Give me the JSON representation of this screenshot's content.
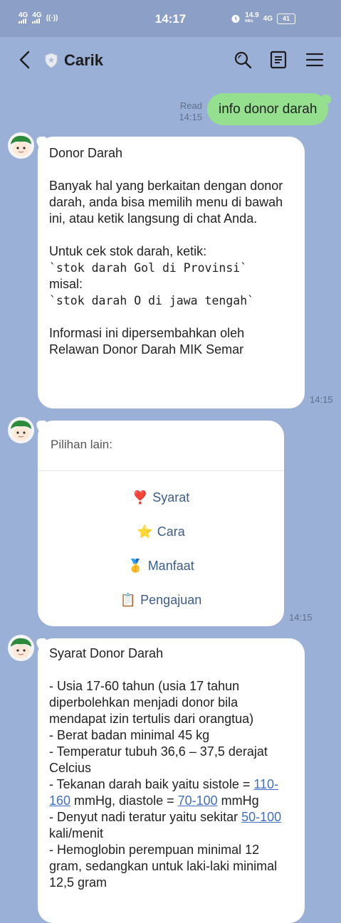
{
  "status": {
    "signal1": "4G",
    "signal2": "4G",
    "time": "14:17",
    "speed": "14.9",
    "speed_unit": "KB/s",
    "net": "4G",
    "battery": "41"
  },
  "header": {
    "title": "Carik"
  },
  "messages": {
    "outgoing": {
      "text": "info donor darah",
      "read": "Read",
      "time": "14:15"
    },
    "m1": {
      "title": "Donor Darah",
      "para1": "Banyak hal yang berkaitan dengan donor darah, anda bisa memilih menu di bawah ini, atau ketik langsung di chat Anda.",
      "line_cek": "Untuk cek stok darah, ketik:",
      "code1": "`stok darah Gol di Provinsi`",
      "misal": "misal:",
      "code2": "`stok darah O di jawa tengah`",
      "info": "Informasi ini dipersembahkan oleh Relawan Donor Darah MIK Semar",
      "time": "14:15"
    },
    "m2": {
      "header": "Pilihan lain:",
      "options": [
        {
          "emoji": "❣️",
          "label": "Syarat"
        },
        {
          "emoji": "⭐",
          "label": "Cara"
        },
        {
          "emoji": "🥇",
          "label": "Manfaat"
        },
        {
          "emoji": "📋",
          "label": "Pengajuan"
        }
      ],
      "time": "14:15"
    },
    "m3": {
      "title": "Syarat Donor Darah",
      "l1": "- Usia 17-60 tahun (usia 17 tahun diperbolehkan menjadi donor bila mendapat izin tertulis dari orangtua)",
      "l2": "- Berat badan minimal 45 kg",
      "l3": "- Temperatur tubuh 36,6 – 37,5 derajat Celcius",
      "l4a": "- Tekanan darah baik yaitu sistole = ",
      "l4link1": "110-160",
      "l4b": " mmHg, diastole = ",
      "l4link2": "70-100",
      "l4c": " mmHg",
      "l5a": "- Denyut nadi teratur yaitu sekitar ",
      "l5link": "50-100",
      "l5b": " kali/menit",
      "l6": "- Hemoglobin perempuan minimal 12 gram, sedangkan untuk laki-laki minimal 12,5 gram"
    }
  }
}
